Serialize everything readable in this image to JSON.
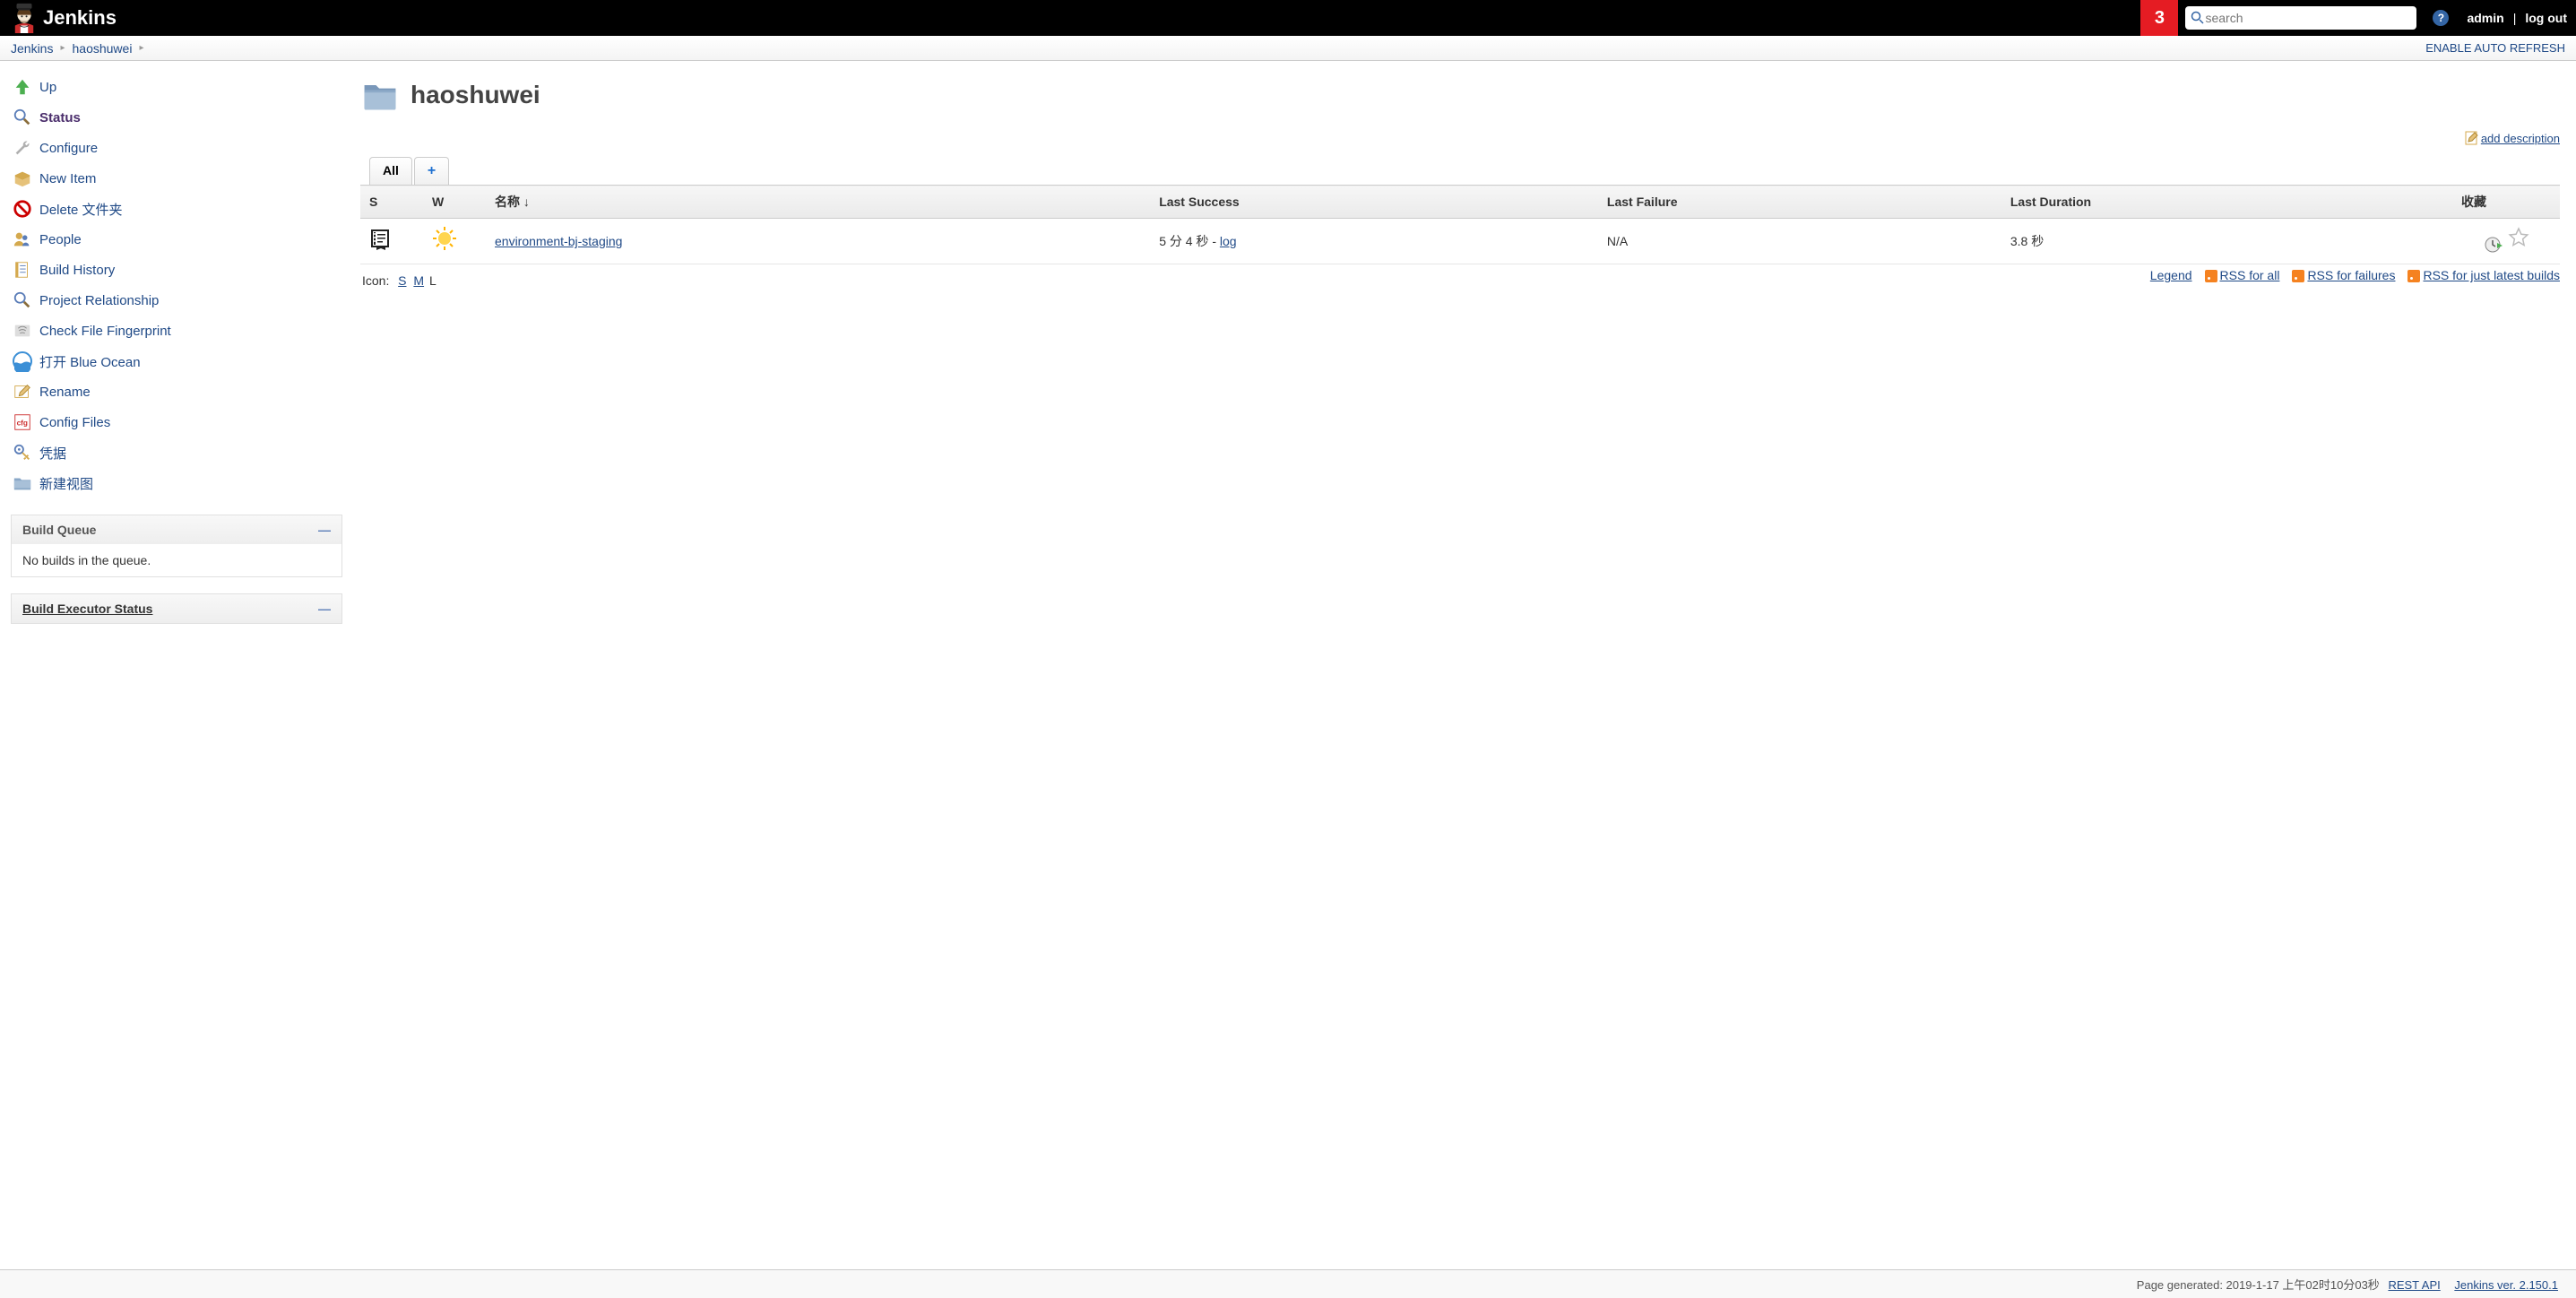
{
  "header": {
    "brand": "Jenkins",
    "notification_count": "3",
    "search_placeholder": "search",
    "user": "admin",
    "logout": "log out"
  },
  "breadcrumbs": {
    "root": "Jenkins",
    "folder": "haoshuwei",
    "auto_refresh": "ENABLE AUTO REFRESH"
  },
  "sidebar": {
    "items": [
      {
        "label": "Up"
      },
      {
        "label": "Status"
      },
      {
        "label": "Configure"
      },
      {
        "label": "New Item"
      },
      {
        "label": "Delete 文件夹"
      },
      {
        "label": "People"
      },
      {
        "label": "Build History"
      },
      {
        "label": "Project Relationship"
      },
      {
        "label": "Check File Fingerprint"
      },
      {
        "label": "打开 Blue Ocean"
      },
      {
        "label": "Rename"
      },
      {
        "label": "Config Files"
      },
      {
        "label": "凭据"
      },
      {
        "label": "新建视图"
      }
    ],
    "build_queue_title": "Build Queue",
    "build_queue_empty": "No builds in the queue.",
    "build_executor_title": "Build Executor Status"
  },
  "main": {
    "title": "haoshuwei",
    "add_description": "add description",
    "tabs": {
      "all": "All",
      "add": "+"
    },
    "columns": {
      "s": "S",
      "w": "W",
      "name": "名称 ↓",
      "last_success": "Last Success",
      "last_failure": "Last Failure",
      "last_duration": "Last Duration",
      "fav": "收藏"
    },
    "rows": [
      {
        "name": "environment-bj-staging",
        "last_success": "5 分 4 秒 - ",
        "last_success_log": "log",
        "last_failure": "N/A",
        "last_duration": "3.8 秒"
      }
    ],
    "icon_label": "Icon:",
    "icon_s": "S",
    "icon_m": "M",
    "icon_l": "L",
    "legend": "Legend",
    "rss_all": "RSS for all",
    "rss_fail": "RSS for failures",
    "rss_latest": "RSS for just latest builds"
  },
  "footer": {
    "generated": "Page generated: 2019-1-17 上午02时10分03秒",
    "rest": "REST API",
    "version": "Jenkins ver. 2.150.1"
  }
}
